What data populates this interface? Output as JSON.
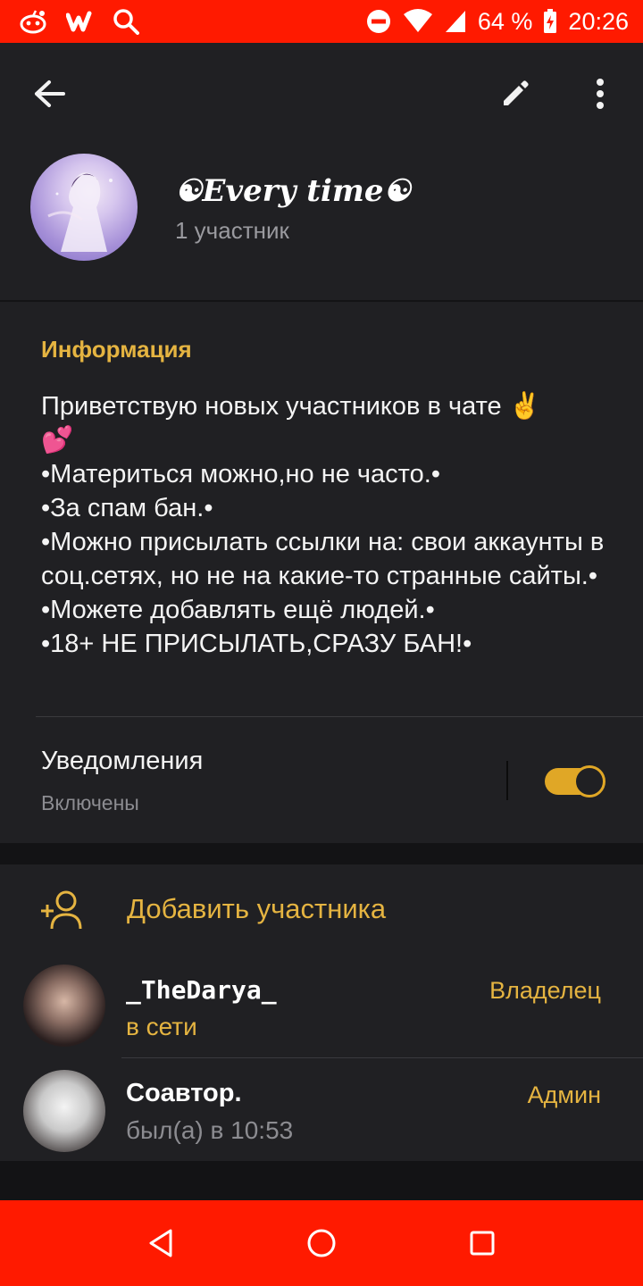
{
  "status_bar": {
    "battery": "64 %",
    "time": "20:26",
    "icons_left": [
      "reddit-alien-icon",
      "wattpad-icon",
      "search-icon"
    ],
    "icons_right": [
      "do-not-disturb-icon",
      "wifi-icon",
      "signal-icon",
      "battery-charging-icon"
    ]
  },
  "header": {
    "back_icon": "arrow-left-icon",
    "edit_icon": "pencil-icon",
    "more_icon": "more-vertical-icon",
    "title": "☯Every time☯",
    "subtitle": "1 участник"
  },
  "info": {
    "heading": "Информация",
    "lines": [
      "Приветствую новых участников в чате ✌️",
      "💕",
      "•Материться можно,но не часто.•",
      "•За спам бан.•",
      "•Можно присылать ссылки на: свои аккаунты в соц.сетях, но не на какие-то странные сайты.•",
      "•Можете добавлять ещё людей.•",
      "•18+ НЕ ПРИСЫЛАТЬ,СРАЗУ БАН!•"
    ]
  },
  "notifications": {
    "label": "Уведомления",
    "state": "Включены",
    "enabled": true
  },
  "members": {
    "add_label": "Добавить участника",
    "list": [
      {
        "name": "_TheDarya_",
        "status": "в сети",
        "role": "Владелец"
      },
      {
        "name": "Соавтор.",
        "status": "был(а) в 10:53",
        "role": "Админ"
      }
    ]
  },
  "colors": {
    "accent": "#e5b441",
    "system_bars": "#ff1a00",
    "card": "#202023",
    "background": "#131315"
  },
  "nav": {
    "icons": [
      "back-triangle-icon",
      "home-circle-icon",
      "recents-square-icon"
    ]
  }
}
